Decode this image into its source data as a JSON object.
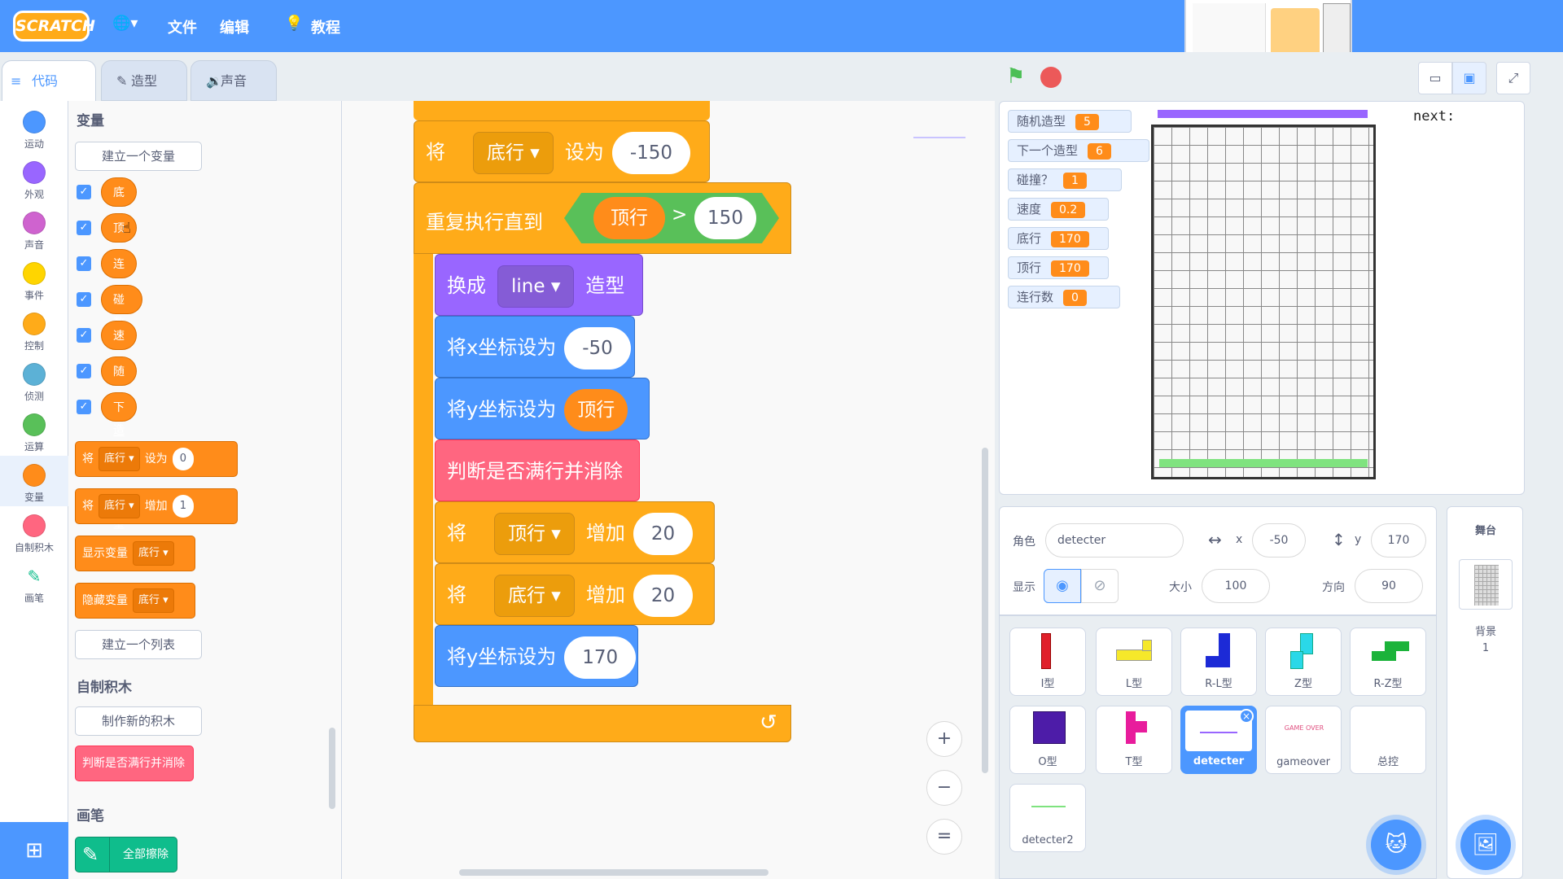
{
  "menu": {
    "logo": "SCRATCH",
    "file": "文件",
    "edit": "编辑",
    "tutorials": "教程"
  },
  "tabs": {
    "code": "代码",
    "costumes": "造型",
    "sounds": "声音"
  },
  "categories": [
    "运动",
    "外观",
    "声音",
    "事件",
    "控制",
    "侦测",
    "运算",
    "变量",
    "自制积木",
    "画笔"
  ],
  "category_colors": [
    "#4c97ff",
    "#9966ff",
    "#cf63cf",
    "#ffd500",
    "#ffab19",
    "#5cb1d6",
    "#59c059",
    "#ff8c1a",
    "#ff6680",
    "#0fbd8c"
  ],
  "palette": {
    "var_title": "变量",
    "make_var": "建立一个变量",
    "variables": [
      "底行",
      "顶行",
      "连行数",
      "碰撞?",
      "速度",
      "随机造型",
      "下一个造型"
    ],
    "set_block": {
      "word": "将",
      "var": "底行",
      "to": "设为",
      "val": "0"
    },
    "change_block": {
      "word": "将",
      "var": "底行",
      "by": "增加",
      "val": "1"
    },
    "show_var": {
      "word": "显示变量",
      "var": "底行"
    },
    "hide_var": {
      "word": "隐藏变量",
      "var": "底行"
    },
    "make_list": "建立一个列表",
    "myblocks_title": "自制积木",
    "make_block": "制作新的积木",
    "custom_block": "判断是否满行并消除",
    "pen_title": "画笔",
    "clear_all": "全部擦除"
  },
  "script": {
    "set_bottom": {
      "word": "将",
      "var": "底行",
      "to": "设为",
      "val": "-150"
    },
    "repeat_until": "重复执行直到",
    "cond": {
      "var": "顶行",
      "op": ">",
      "val": "150"
    },
    "switch_costume": {
      "word": "换成",
      "costume": "line",
      "suffix": "造型"
    },
    "set_x": {
      "label": "将x坐标设为",
      "val": "-50"
    },
    "set_y_var": {
      "label": "将y坐标设为",
      "var": "顶行"
    },
    "custom_call": "判断是否满行并消除",
    "change_top": {
      "word": "将",
      "var": "顶行",
      "by": "增加",
      "val": "20"
    },
    "change_bottom": {
      "word": "将",
      "var": "底行",
      "by": "增加",
      "val": "20"
    },
    "set_y_170": {
      "label": "将y坐标设为",
      "val": "170"
    }
  },
  "zoom": {
    "in": "+",
    "out": "−",
    "reset": "="
  },
  "monitors": [
    {
      "label": "随机造型",
      "value": "5"
    },
    {
      "label": "下一个造型",
      "value": "6"
    },
    {
      "label": "碰撞？",
      "value": "1"
    },
    {
      "label": "速度",
      "value": "0.2"
    },
    {
      "label": "底行",
      "value": "170"
    },
    {
      "label": "顶行",
      "value": "170"
    },
    {
      "label": "连行数",
      "value": "0"
    }
  ],
  "stage": {
    "next_label": "next:"
  },
  "sprite_info": {
    "sprite_label": "角色",
    "sprite_name": "detecter",
    "x_label": "x",
    "x": "-50",
    "y_label": "y",
    "y": "170",
    "show_label": "显示",
    "size_label": "大小",
    "size": "100",
    "direction_label": "方向",
    "direction": "90"
  },
  "sprites": [
    "I型",
    "L型",
    "R-L型",
    "Z型",
    "R-Z型",
    "O型",
    "T型",
    "detecter",
    "gameover",
    "总控",
    "detecter2"
  ],
  "gameover_thumb": "GAME OVER",
  "stage_panel": {
    "title": "舞台",
    "backdrop_label": "背景",
    "backdrop_count": "1"
  }
}
